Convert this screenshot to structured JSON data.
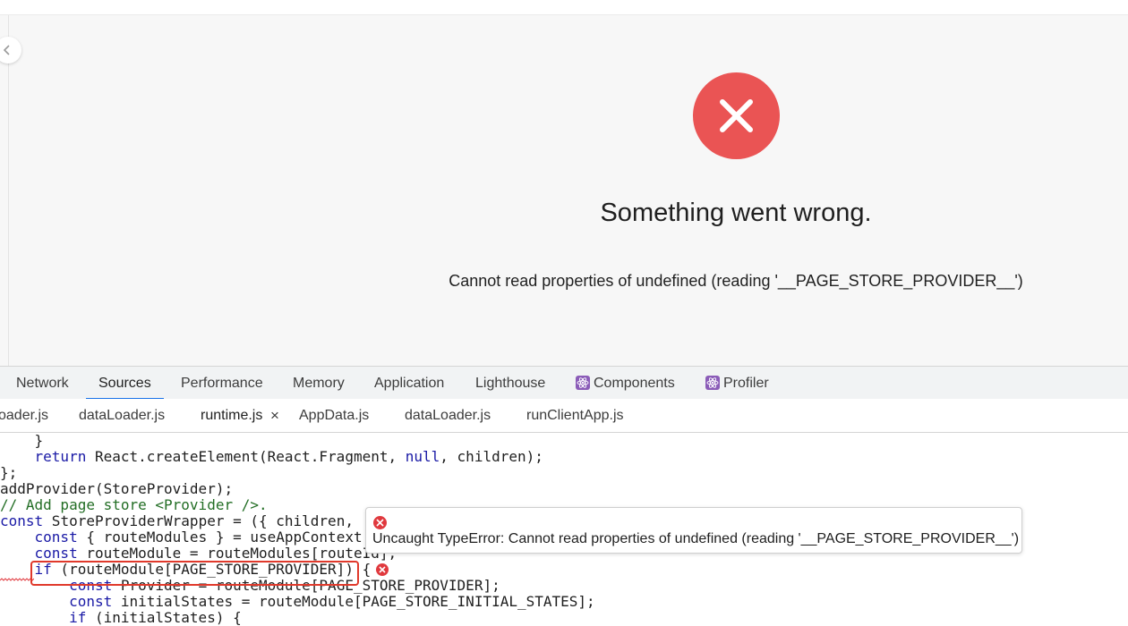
{
  "page": {
    "title": "Something went wrong.",
    "message": "Cannot read properties of undefined (reading '__PAGE_STORE_PROVIDER__')"
  },
  "devtools": {
    "tabs": [
      {
        "label": "Network"
      },
      {
        "label": "Sources",
        "active": true
      },
      {
        "label": "Performance"
      },
      {
        "label": "Memory"
      },
      {
        "label": "Application"
      },
      {
        "label": "Lighthouse"
      },
      {
        "label": "Components",
        "icon": "react-icon"
      },
      {
        "label": "Profiler",
        "icon": "react-icon"
      }
    ],
    "file_tabs": [
      {
        "label": "oader.js"
      },
      {
        "label": "dataLoader.js"
      },
      {
        "label": "runtime.js",
        "active": true,
        "close": "×"
      },
      {
        "label": "AppData.js"
      },
      {
        "label": "dataLoader.js"
      },
      {
        "label": "runClientApp.js"
      }
    ]
  },
  "code": {
    "lines": [
      "    }",
      "    return React.createElement(React.Fragment, null, children);",
      "};",
      "addProvider(StoreProvider);",
      "// Add page store <Provider />.",
      "const StoreProviderWrapper = ({ children,",
      "    const { routeModules } = useAppContext",
      "    const routeModule = routeModules[routeId];",
      "    if (routeModule[PAGE_STORE_PROVIDER]) {",
      "        const Provider = routeModule[PAGE_STORE_PROVIDER];",
      "        const initialStates = routeModule[PAGE_STORE_INITIAL_STATES];",
      "        if (initialStates) {"
    ],
    "error_tooltip": "Uncaught TypeError: Cannot read properties of undefined (reading '__PAGE_STORE_PROVIDER__')"
  },
  "colors": {
    "error_red": "#ea5454",
    "accent_blue": "#1a73e8",
    "highlight_box": "#e0392b",
    "keyword": "#1a1aa6",
    "comment": "#236e25"
  }
}
